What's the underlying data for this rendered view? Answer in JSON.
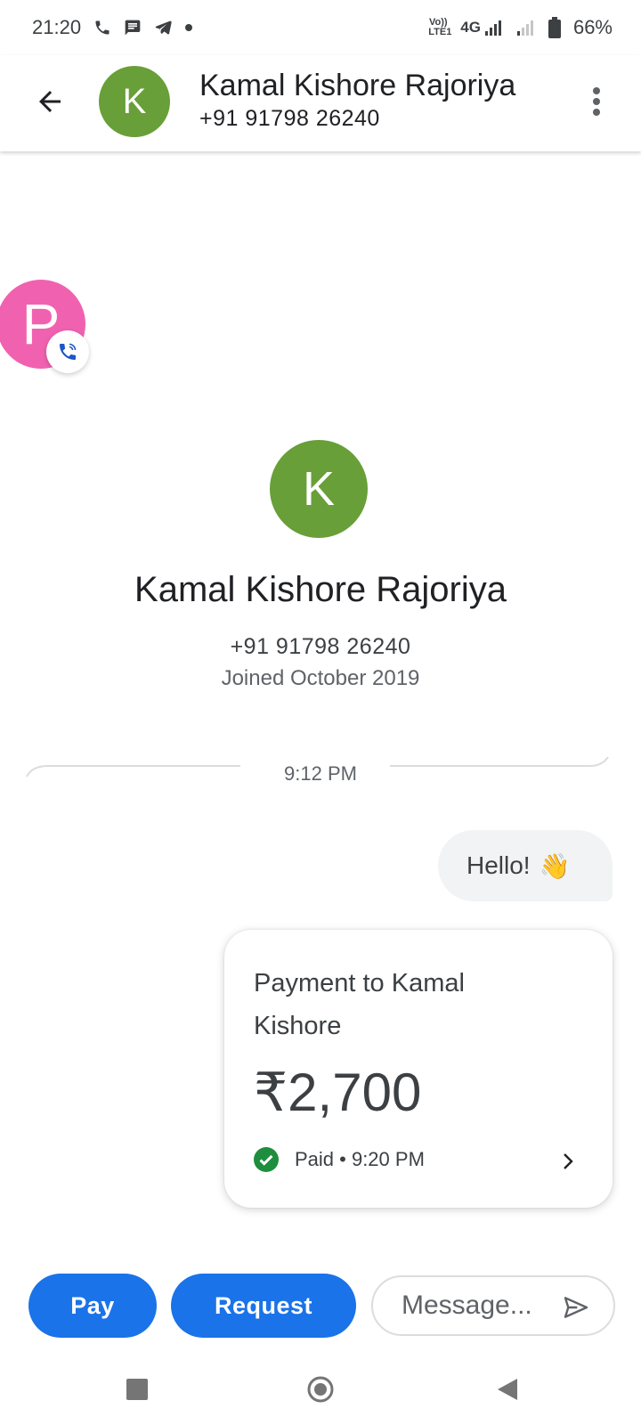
{
  "status_bar": {
    "time": "21:20",
    "volte_label": "Vo)) LTE1",
    "network": "4G",
    "battery": "66%"
  },
  "header": {
    "avatar_letter": "K",
    "name": "Kamal Kishore Rajoriya",
    "phone": "+91 91798 26240"
  },
  "chat_head": {
    "letter": "P"
  },
  "profile": {
    "avatar_letter": "K",
    "name": "Kamal Kishore Rajoriya",
    "phone": "+91 91798 26240",
    "joined": "Joined October 2019"
  },
  "conversation": {
    "time_divider": "9:12 PM",
    "message_text": "Hello!",
    "message_emoji": "👋",
    "payment": {
      "title": "Payment to Kamal Kishore",
      "amount": "₹2,700",
      "status": "Paid • 9:20 PM"
    }
  },
  "actions": {
    "pay_label": "Pay",
    "request_label": "Request",
    "message_placeholder": "Message..."
  },
  "colors": {
    "avatar_green": "#689f38",
    "chat_head_pink": "#f062b0",
    "primary_blue": "#1a73e8",
    "paid_green": "#1e8e3e"
  },
  "icons": [
    "back-arrow-icon",
    "more-vert-icon",
    "phone-icon",
    "message-icon",
    "telegram-icon",
    "signal-icon",
    "battery-icon",
    "check-circle-icon",
    "chevron-right-icon",
    "send-icon",
    "recents-icon",
    "home-icon",
    "back-icon"
  ]
}
